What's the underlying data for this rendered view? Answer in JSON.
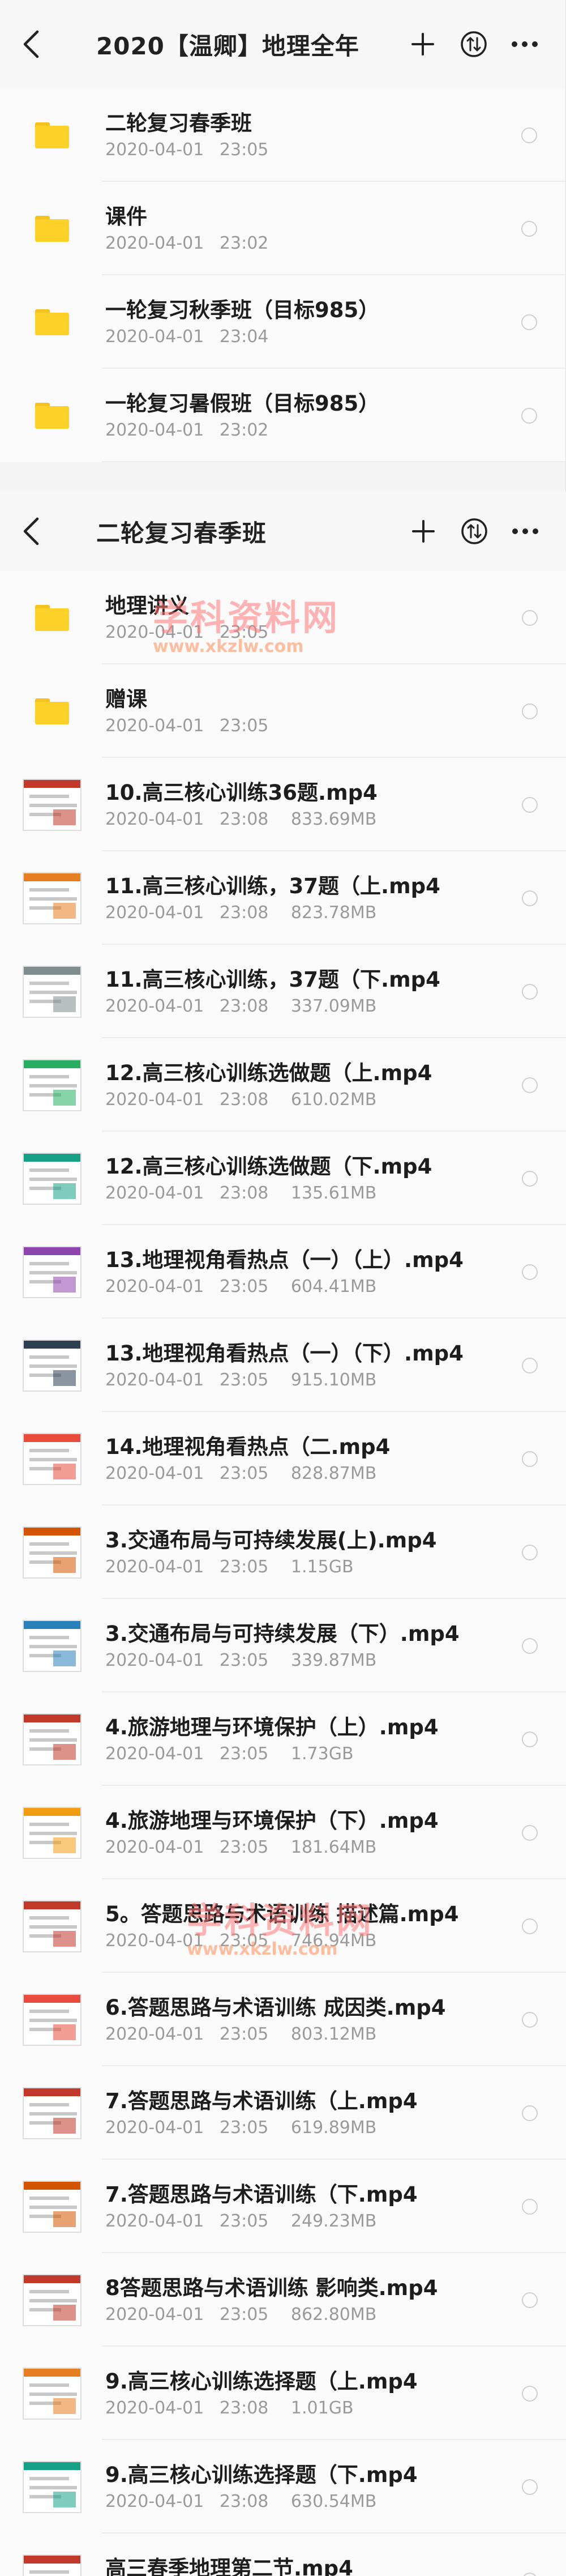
{
  "panel1": {
    "header": {
      "title": "2020【温卿】地理全年"
    },
    "rows": [
      {
        "name": "二轮复习春季班",
        "date": "2020-04-01",
        "time": "23:05",
        "size": ""
      },
      {
        "name": "课件",
        "date": "2020-04-01",
        "time": "23:02",
        "size": ""
      },
      {
        "name": "一轮复习秋季班（目标985）",
        "date": "2020-04-01",
        "time": "23:04",
        "size": ""
      },
      {
        "name": "一轮复习暑假班（目标985）",
        "date": "2020-04-01",
        "time": "23:02",
        "size": ""
      }
    ]
  },
  "panel2": {
    "header": {
      "title": "二轮复习春季班"
    },
    "folders": [
      {
        "name": "地理讲义",
        "date": "2020-04-01",
        "time": "23:05",
        "size": ""
      },
      {
        "name": "赠课",
        "date": "2020-04-01",
        "time": "23:05",
        "size": ""
      }
    ],
    "files": [
      {
        "name": "10.高三核心训练36题.mp4",
        "date": "2020-04-01",
        "time": "23:08",
        "size": "833.69MB",
        "accent": "#c0392b"
      },
      {
        "name": "11.高三核心训练，37题（上.mp4",
        "date": "2020-04-01",
        "time": "23:08",
        "size": "823.78MB",
        "accent": "#e67e22"
      },
      {
        "name": "11.高三核心训练，37题（下.mp4",
        "date": "2020-04-01",
        "time": "23:08",
        "size": "337.09MB",
        "accent": "#7f8c8d"
      },
      {
        "name": "12.高三核心训练选做题（上.mp4",
        "date": "2020-04-01",
        "time": "23:08",
        "size": "610.02MB",
        "accent": "#27ae60"
      },
      {
        "name": "12.高三核心训练选做题（下.mp4",
        "date": "2020-04-01",
        "time": "23:08",
        "size": "135.61MB",
        "accent": "#16a085"
      },
      {
        "name": "13.地理视角看热点（一）（上）.mp4",
        "date": "2020-04-01",
        "time": "23:05",
        "size": "604.41MB",
        "accent": "#8e44ad"
      },
      {
        "name": "13.地理视角看热点（一）（下）.mp4",
        "date": "2020-04-01",
        "time": "23:05",
        "size": "915.10MB",
        "accent": "#2c3e50"
      },
      {
        "name": "14.地理视角看热点（二.mp4",
        "date": "2020-04-01",
        "time": "23:05",
        "size": "828.87MB",
        "accent": "#e74c3c"
      },
      {
        "name": "3.交通布局与可持续发展(上).mp4",
        "date": "2020-04-01",
        "time": "23:05",
        "size": "1.15GB",
        "accent": "#d35400"
      },
      {
        "name": "3.交通布局与可持续发展（下）.mp4",
        "date": "2020-04-01",
        "time": "23:05",
        "size": "339.87MB",
        "accent": "#2980b9"
      },
      {
        "name": "4.旅游地理与环境保护（上）.mp4",
        "date": "2020-04-01",
        "time": "23:05",
        "size": "1.73GB",
        "accent": "#c0392b"
      },
      {
        "name": "4.旅游地理与环境保护（下）.mp4",
        "date": "2020-04-01",
        "time": "23:05",
        "size": "181.64MB",
        "accent": "#f39c12"
      },
      {
        "name": "5。答题思路与术语训练 描述篇.mp4",
        "date": "2020-04-01",
        "time": "23:05",
        "size": "746.94MB",
        "accent": "#c0392b"
      },
      {
        "name": "6.答题思路与术语训练 成因类.mp4",
        "date": "2020-04-01",
        "time": "23:05",
        "size": "803.12MB",
        "accent": "#e74c3c"
      },
      {
        "name": "7.答题思路与术语训练（上.mp4",
        "date": "2020-04-01",
        "time": "23:05",
        "size": "619.89MB",
        "accent": "#c0392b"
      },
      {
        "name": "7.答题思路与术语训练（下.mp4",
        "date": "2020-04-01",
        "time": "23:05",
        "size": "249.23MB",
        "accent": "#d35400"
      },
      {
        "name": "8答题思路与术语训练 影响类.mp4",
        "date": "2020-04-01",
        "time": "23:05",
        "size": "862.80MB",
        "accent": "#c0392b"
      },
      {
        "name": "9.高三核心训练选择题（上.mp4",
        "date": "2020-04-01",
        "time": "23:08",
        "size": "1.01GB",
        "accent": "#e67e22"
      },
      {
        "name": "9.高三核心训练选择题（下.mp4",
        "date": "2020-04-01",
        "time": "23:08",
        "size": "630.54MB",
        "accent": "#16a085"
      },
      {
        "name": "高三春季地理第二节.mp4",
        "date": "",
        "time": "",
        "size": "",
        "accent": "#c0392b"
      }
    ]
  },
  "watermark": {
    "text": "学科资料网",
    "url": "www.xkzlw.com"
  },
  "colors": {
    "folder": "#fcd12a",
    "background": "#f4f4f4",
    "meta_text": "#9a9a9a"
  }
}
